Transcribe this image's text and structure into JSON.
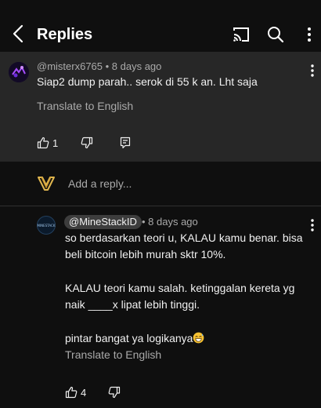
{
  "header": {
    "title": "Replies"
  },
  "parent_comment": {
    "meta": "@misterx6765 • 8 days ago",
    "text": "Siap2 dump parah.. serok di 55 k an.  Lht saja",
    "translate": "Translate to English",
    "likes": "1"
  },
  "reply_input": {
    "placeholder": "Add a reply..."
  },
  "reply_comment": {
    "author": "@MineStackID",
    "time": "• 8 days ago",
    "avatar_text": "MINESTACK",
    "lines": [
      "so berdasarkan teori u, KALAU kamu benar. bisa beli bitcoin lebih murah sktr 10%.",
      "KALAU teori kamu salah. ketinggalan kereta yg naik ____x lipat lebih tinggi.",
      "pintar bangat ya logikanya"
    ],
    "translate": "Translate to English",
    "likes": "4"
  },
  "icons": [
    "back-arrow-icon",
    "cast-icon",
    "search-icon",
    "more-vert-icon",
    "thumb-up-icon",
    "thumb-down-icon",
    "reply-icon",
    "grin-sweat-emoji-icon"
  ],
  "colors": {
    "background": "#0f0f0f",
    "highlight": "#272727",
    "secondary_text": "#aaaaaa",
    "chip": "#3d3d3d"
  }
}
